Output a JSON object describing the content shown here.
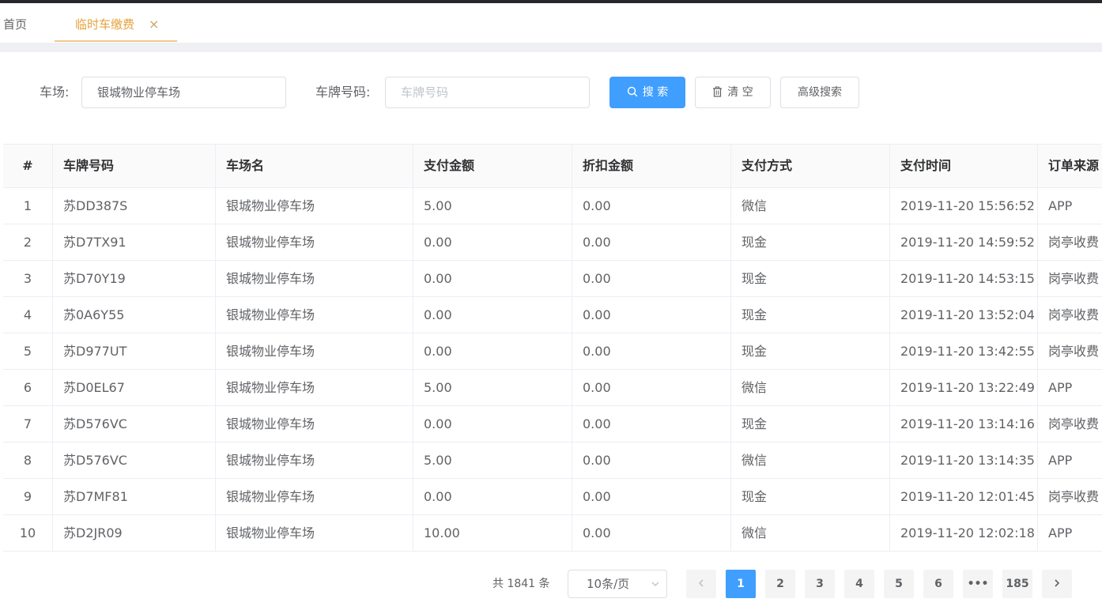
{
  "tabs": {
    "home": "首页",
    "active": "临时车缴费",
    "close_glyph": "×"
  },
  "search": {
    "lot_label": "车场:",
    "lot_value": "银城物业停车场",
    "plate_label": "车牌号码:",
    "plate_placeholder": "车牌号码",
    "search_button": "搜 索",
    "clear_button": "清 空",
    "advanced_button": "高级搜索"
  },
  "table": {
    "columns": [
      "#",
      "车牌号码",
      "车场名",
      "支付金额",
      "折扣金额",
      "支付方式",
      "支付时间",
      "订单来源"
    ],
    "rows": [
      [
        "1",
        "苏DD387S",
        "银城物业停车场",
        "5.00",
        "0.00",
        "微信",
        "2019-11-20 15:56:52",
        "APP"
      ],
      [
        "2",
        "苏D7TX91",
        "银城物业停车场",
        "0.00",
        "0.00",
        "现金",
        "2019-11-20 14:59:52",
        "岗亭收费"
      ],
      [
        "3",
        "苏D70Y19",
        "银城物业停车场",
        "0.00",
        "0.00",
        "现金",
        "2019-11-20 14:53:15",
        "岗亭收费"
      ],
      [
        "4",
        "苏0A6Y55",
        "银城物业停车场",
        "0.00",
        "0.00",
        "现金",
        "2019-11-20 13:52:04",
        "岗亭收费"
      ],
      [
        "5",
        "苏D977UT",
        "银城物业停车场",
        "0.00",
        "0.00",
        "现金",
        "2019-11-20 13:42:55",
        "岗亭收费"
      ],
      [
        "6",
        "苏D0EL67",
        "银城物业停车场",
        "5.00",
        "0.00",
        "微信",
        "2019-11-20 13:22:49",
        "APP"
      ],
      [
        "7",
        "苏D576VC",
        "银城物业停车场",
        "0.00",
        "0.00",
        "现金",
        "2019-11-20 13:14:16",
        "岗亭收费"
      ],
      [
        "8",
        "苏D576VC",
        "银城物业停车场",
        "5.00",
        "0.00",
        "微信",
        "2019-11-20 13:14:35",
        "APP"
      ],
      [
        "9",
        "苏D7MF81",
        "银城物业停车场",
        "0.00",
        "0.00",
        "现金",
        "2019-11-20 12:01:45",
        "岗亭收费"
      ],
      [
        "10",
        "苏D2JR09",
        "银城物业停车场",
        "10.00",
        "0.00",
        "微信",
        "2019-11-20 12:02:18",
        "APP"
      ]
    ]
  },
  "pagination": {
    "total": "共 1841 条",
    "page_size": "10条/页",
    "pages": [
      "1",
      "2",
      "3",
      "4",
      "5",
      "6",
      "•••",
      "185"
    ],
    "current": "1"
  },
  "colors": {
    "primary": "#409eff",
    "tab_active": "#e6a23c"
  },
  "icons": {
    "search": "search-icon",
    "clear": "trash-icon",
    "prev": "chevron-left-icon",
    "next": "chevron-right-icon",
    "select": "chevron-down-icon"
  }
}
